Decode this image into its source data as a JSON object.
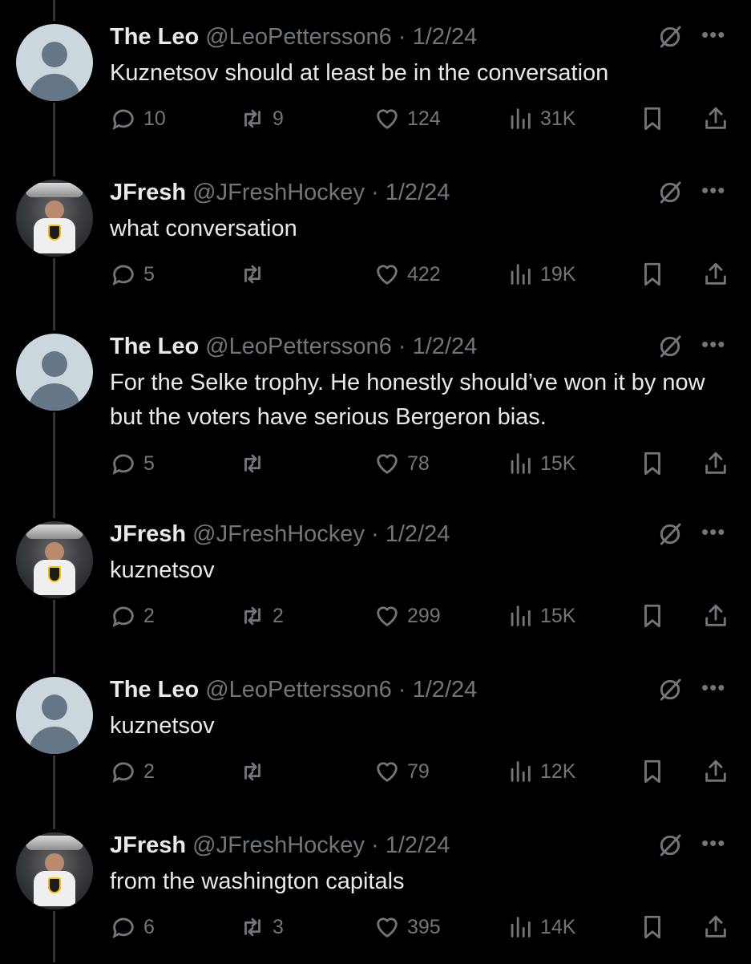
{
  "tweets": [
    {
      "avatar": "default",
      "name": "The Leo",
      "handle": "@LeoPettersson6",
      "date": "1/2/24",
      "text": "Kuznetsov should at least be in the conversation",
      "replies": "10",
      "retweets": "9",
      "likes": "124",
      "views": "31K"
    },
    {
      "avatar": "photo",
      "name": "JFresh",
      "handle": "@JFreshHockey",
      "date": "1/2/24",
      "text": "what conversation",
      "replies": "5",
      "retweets": "",
      "likes": "422",
      "views": "19K"
    },
    {
      "avatar": "default",
      "name": "The Leo",
      "handle": "@LeoPettersson6",
      "date": "1/2/24",
      "text": "For the Selke trophy. He honestly should’ve won it by now but the voters have serious Bergeron bias.",
      "replies": "5",
      "retweets": "",
      "likes": "78",
      "views": "15K"
    },
    {
      "avatar": "photo",
      "name": "JFresh",
      "handle": "@JFreshHockey",
      "date": "1/2/24",
      "text": "kuznetsov",
      "replies": "2",
      "retweets": "2",
      "likes": "299",
      "views": "15K"
    },
    {
      "avatar": "default",
      "name": "The Leo",
      "handle": "@LeoPettersson6",
      "date": "1/2/24",
      "text": "kuznetsov",
      "replies": "2",
      "retweets": "",
      "likes": "79",
      "views": "12K"
    },
    {
      "avatar": "photo",
      "name": "JFresh",
      "handle": "@JFreshHockey",
      "date": "1/2/24",
      "text": "from the washington capitals",
      "replies": "6",
      "retweets": "3",
      "likes": "395",
      "views": "14K"
    }
  ],
  "separator": "·",
  "more_glyph": "•••"
}
